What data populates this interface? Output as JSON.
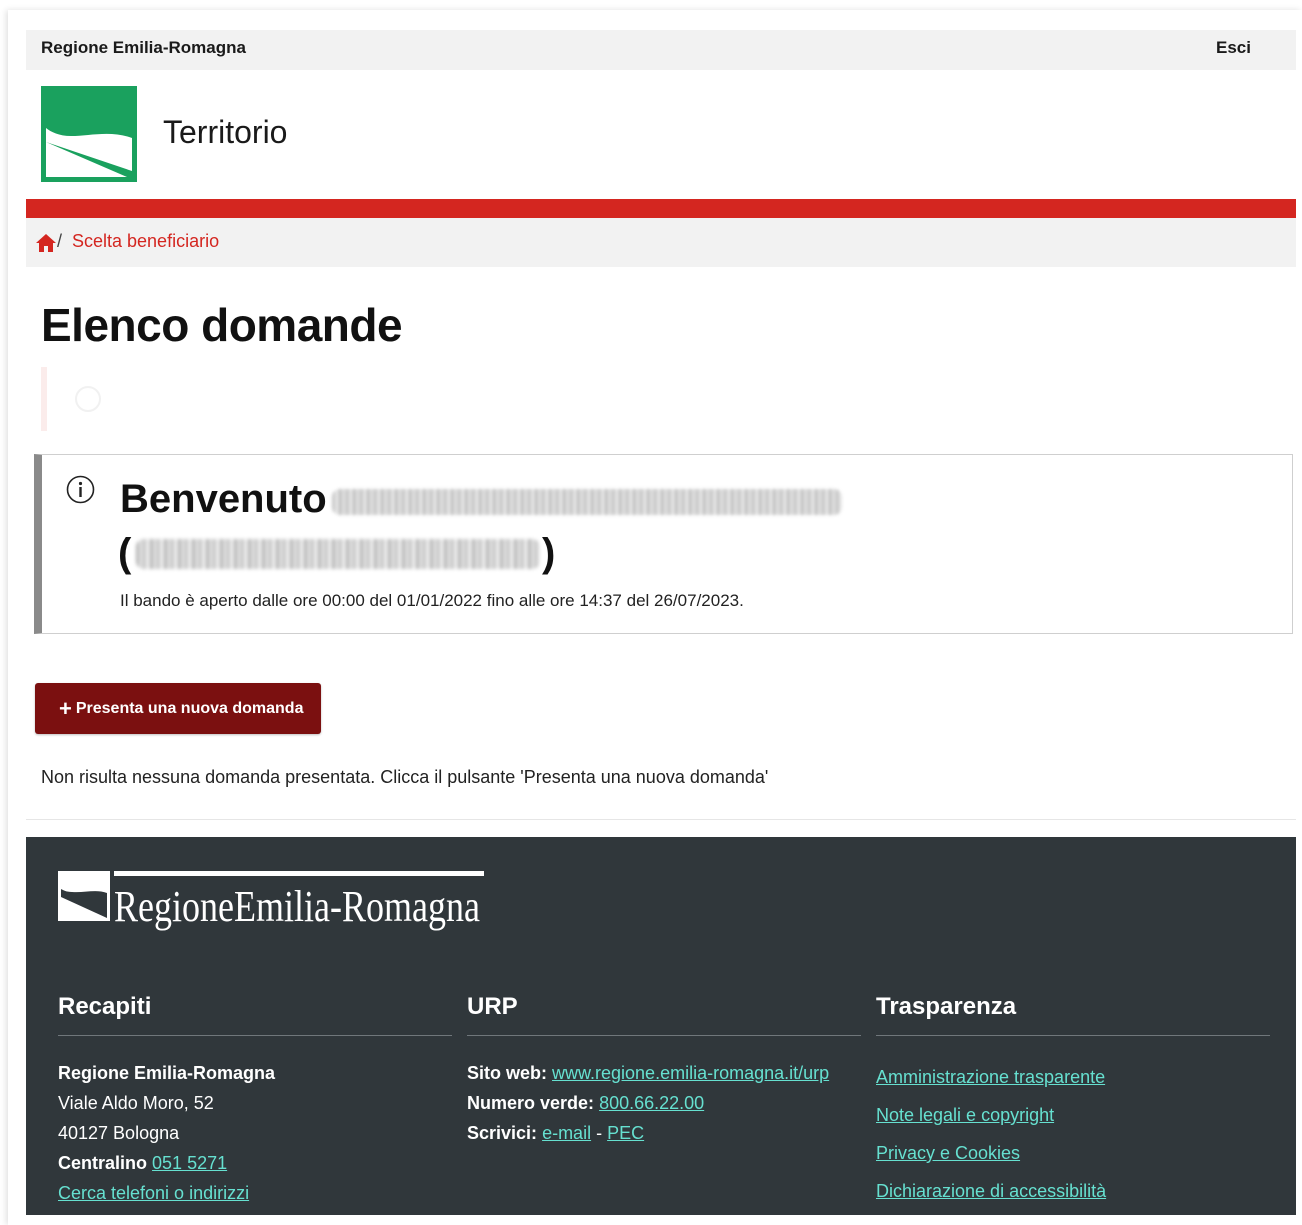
{
  "topbar": {
    "brand": "Regione Emilia-Romagna",
    "logout": "Esci"
  },
  "header": {
    "site_title": "Territorio"
  },
  "breadcrumb": {
    "separator": "/",
    "current": "Scelta beneficiario"
  },
  "page": {
    "title": "Elenco domande"
  },
  "info": {
    "welcome": "Benvenuto",
    "paren_open": "(",
    "paren_close": ")",
    "bando_text": "Il bando è aperto dalle ore 00:00 del 01/01/2022 fino alle ore 14:37 del 26/07/2023."
  },
  "actions": {
    "plus": "+",
    "new_label": "Presenta una nuova domanda"
  },
  "empty_message": "Non risulta nessuna domanda presentata. Clicca il pulsante 'Presenta una nuova domanda'",
  "footer": {
    "logo_text": "RegioneEmilia-Romagna",
    "recapiti": {
      "title": "Recapiti",
      "org": "Regione Emilia-Romagna",
      "address": "Viale Aldo Moro, 52",
      "city": "40127 Bologna",
      "centralino_label": "Centralino",
      "centralino_number": "051 5271",
      "search_link": "Cerca telefoni o indirizzi"
    },
    "urp": {
      "title": "URP",
      "site_label": "Sito web:",
      "site_link": "www.regione.emilia-romagna.it/urp",
      "verde_label": "Numero verde:",
      "verde_link": "800.66.22.00",
      "write_label": "Scrivici:",
      "email_link": "e-mail",
      "dash": "-",
      "pec_link": "PEC"
    },
    "trasparenza": {
      "title": "Trasparenza",
      "links": [
        "Amministrazione trasparente",
        "Note legali e copyright",
        "Privacy e Cookies",
        "Dichiarazione di accessibilità"
      ]
    }
  },
  "colors": {
    "accent_red": "#d42620",
    "button": "#7b1010",
    "footer_bg": "#30373b",
    "footer_link": "#66e0d0",
    "logo_green": "#1aa15e"
  }
}
